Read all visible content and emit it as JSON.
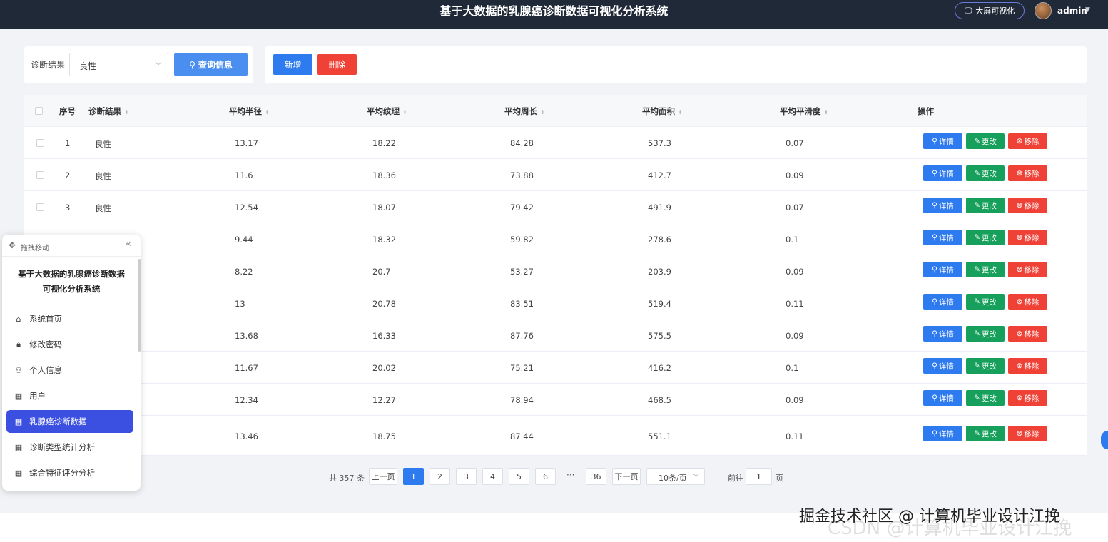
{
  "header": {
    "title": "基于大数据的乳腺癌诊断数据可视化分析系统",
    "screen_button": "大屏可视化",
    "user": "admin"
  },
  "filter": {
    "label": "诊断结果",
    "selected": "良性",
    "search_button": "查询信息"
  },
  "actions": {
    "add": "新增",
    "delete": "删除"
  },
  "table": {
    "columns": [
      "序号",
      "诊断结果",
      "平均半径",
      "平均纹理",
      "平均周长",
      "平均面积",
      "平均平滑度",
      "操作"
    ],
    "rows": [
      {
        "index": "1",
        "result": "良性",
        "radius": "13.17",
        "texture": "18.22",
        "perimeter": "84.28",
        "area": "537.3",
        "smoothness": "0.07"
      },
      {
        "index": "2",
        "result": "良性",
        "radius": "11.6",
        "texture": "18.36",
        "perimeter": "73.88",
        "area": "412.7",
        "smoothness": "0.09"
      },
      {
        "index": "3",
        "result": "良性",
        "radius": "12.54",
        "texture": "18.07",
        "perimeter": "79.42",
        "area": "491.9",
        "smoothness": "0.07"
      },
      {
        "index": "",
        "result": "",
        "radius": "9.44",
        "texture": "18.32",
        "perimeter": "59.82",
        "area": "278.6",
        "smoothness": "0.1"
      },
      {
        "index": "",
        "result": "",
        "radius": "8.22",
        "texture": "20.7",
        "perimeter": "53.27",
        "area": "203.9",
        "smoothness": "0.09"
      },
      {
        "index": "",
        "result": "",
        "radius": "13",
        "texture": "20.78",
        "perimeter": "83.51",
        "area": "519.4",
        "smoothness": "0.11"
      },
      {
        "index": "",
        "result": "",
        "radius": "13.68",
        "texture": "16.33",
        "perimeter": "87.76",
        "area": "575.5",
        "smoothness": "0.09"
      },
      {
        "index": "",
        "result": "",
        "radius": "11.67",
        "texture": "20.02",
        "perimeter": "75.21",
        "area": "416.2",
        "smoothness": "0.1"
      },
      {
        "index": "",
        "result": "",
        "radius": "12.34",
        "texture": "12.27",
        "perimeter": "78.94",
        "area": "468.5",
        "smoothness": "0.09"
      },
      {
        "index": "",
        "result": "",
        "radius": "13.46",
        "texture": "18.75",
        "perimeter": "87.44",
        "area": "551.1",
        "smoothness": "0.11"
      }
    ],
    "row_actions": {
      "detail": "详情",
      "edit": "更改",
      "remove": "移除"
    }
  },
  "pagination": {
    "total": "共 357 条",
    "prev": "上一页",
    "pages": [
      "1",
      "2",
      "3",
      "4",
      "5",
      "6"
    ],
    "ellipsis": "···",
    "last": "36",
    "next": "下一页",
    "page_size": "10条/页",
    "goto_label": "前往",
    "goto_value": "1",
    "goto_suffix": "页"
  },
  "sidebar": {
    "drag_label": "拖拽移动",
    "title_line1": "基于大数据的乳腺癌诊断数据",
    "title_line2": "可视化分析系统",
    "items": [
      {
        "label": "系统首页",
        "icon": "home-icon"
      },
      {
        "label": "修改密码",
        "icon": "lock-icon"
      },
      {
        "label": "个人信息",
        "icon": "user-icon"
      },
      {
        "label": "用户",
        "icon": "grid-icon"
      },
      {
        "label": "乳腺癌诊断数据",
        "icon": "grid-icon",
        "active": true
      },
      {
        "label": "诊断类型统计分析",
        "icon": "grid-icon"
      },
      {
        "label": "综合特征评分分析",
        "icon": "grid-icon"
      }
    ]
  },
  "watermark": "掘金技术社区 @ 计算机毕业设计江挽",
  "watermark_back": "CSDN @计算机毕业设计江挽",
  "colors": {
    "primary": "#2e7bf0",
    "success": "#16a05b",
    "danger": "#ef4136",
    "header_bg": "#1f2937",
    "sidebar_active": "#3b4fe0"
  }
}
